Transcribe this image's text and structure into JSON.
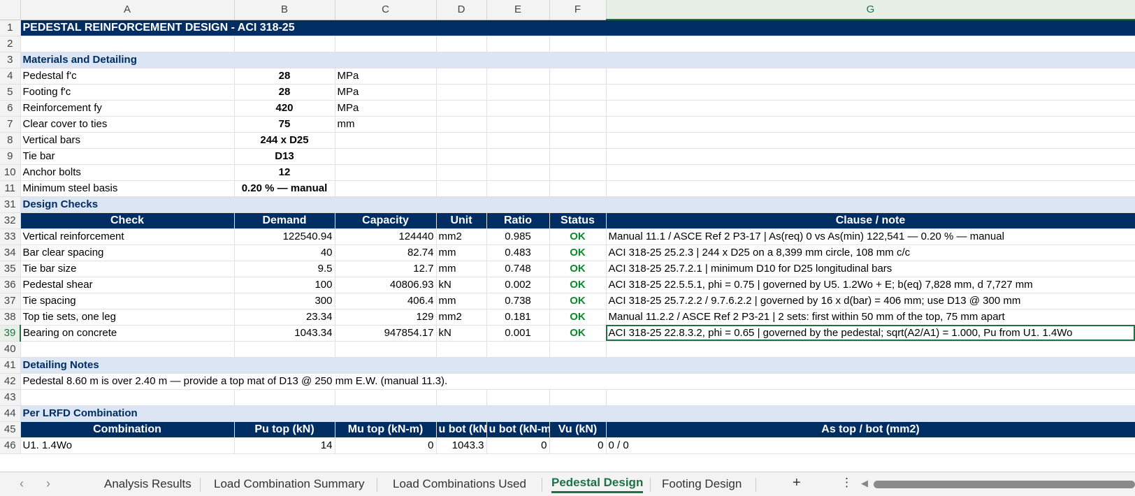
{
  "columns": {
    "a": "A",
    "b": "B",
    "c": "C",
    "d": "D",
    "e": "E",
    "f": "F",
    "g": "G"
  },
  "rows_num": {
    "r1": "1",
    "r2": "2",
    "r3": "3",
    "r4": "4",
    "r5": "5",
    "r6": "6",
    "r7": "7",
    "r8": "8",
    "r9": "9",
    "r10": "10",
    "r11": "11",
    "r31": "31",
    "r32": "32",
    "r33": "33",
    "r34": "34",
    "r35": "35",
    "r36": "36",
    "r37": "37",
    "r38": "38",
    "r39": "39",
    "r40": "40",
    "r41": "41",
    "r42": "42",
    "r43": "43",
    "r44": "44",
    "r45": "45",
    "r46": "46"
  },
  "title": "PEDESTAL REINFORCEMENT DESIGN - ACI 318-25",
  "materials": {
    "heading": "Materials and Detailing",
    "items": [
      {
        "label": "Pedestal f'c",
        "value": "28",
        "unit": "MPa"
      },
      {
        "label": "Footing f'c",
        "value": "28",
        "unit": "MPa"
      },
      {
        "label": "Reinforcement fy",
        "value": "420",
        "unit": "MPa"
      },
      {
        "label": "Clear cover to ties",
        "value": "75",
        "unit": "mm"
      },
      {
        "label": "Vertical bars",
        "value": "244 x D25",
        "unit": ""
      },
      {
        "label": "Tie bar",
        "value": "D13",
        "unit": ""
      },
      {
        "label": "Anchor bolts",
        "value": "12",
        "unit": ""
      },
      {
        "label": "Minimum steel basis",
        "value": "0.20 % — manual",
        "unit": ""
      }
    ]
  },
  "checks": {
    "heading": "Design Checks",
    "headers": {
      "check": "Check",
      "demand": "Demand",
      "capacity": "Capacity",
      "unit": "Unit",
      "ratio": "Ratio",
      "status": "Status",
      "clause": "Clause / note"
    },
    "rows": [
      {
        "check": "Vertical reinforcement",
        "demand": "122540.94",
        "capacity": "124440",
        "unit": "mm2",
        "ratio": "0.985",
        "status": "OK",
        "clause": "Manual 11.1 / ASCE Ref 2 P3-17  |  As(req) 0 vs As(min) 122,541 — 0.20 % — manual"
      },
      {
        "check": "Bar clear spacing",
        "demand": "40",
        "capacity": "82.74",
        "unit": "mm",
        "ratio": "0.483",
        "status": "OK",
        "clause": "ACI 318-25 25.2.3  |  244 x D25 on a 8,399 mm circle, 108 mm c/c"
      },
      {
        "check": "Tie bar size",
        "demand": "9.5",
        "capacity": "12.7",
        "unit": "mm",
        "ratio": "0.748",
        "status": "OK",
        "clause": "ACI 318-25 25.7.2.1  |  minimum D10 for D25 longitudinal bars"
      },
      {
        "check": "Pedestal shear",
        "demand": "100",
        "capacity": "40806.93",
        "unit": "kN",
        "ratio": "0.002",
        "status": "OK",
        "clause": "ACI 318-25 22.5.5.1, phi = 0.75  |  governed by U5. 1.2Wo + E; b(eq) 7,828 mm, d 7,727 mm"
      },
      {
        "check": "Tie spacing",
        "demand": "300",
        "capacity": "406.4",
        "unit": "mm",
        "ratio": "0.738",
        "status": "OK",
        "clause": "ACI 318-25 25.7.2.2 / 9.7.6.2.2  |  governed by 16 x d(bar) = 406 mm; use D13 @ 300 mm"
      },
      {
        "check": "Top tie sets, one leg",
        "demand": "23.34",
        "capacity": "129",
        "unit": "mm2",
        "ratio": "0.181",
        "status": "OK",
        "clause": "Manual 11.2.2 / ASCE Ref 2 P3-21  |  2 sets: first within 50 mm of the top, 75 mm apart"
      },
      {
        "check": "Bearing on concrete",
        "demand": "1043.34",
        "capacity": "947854.17",
        "unit": "kN",
        "ratio": "0.001",
        "status": "OK",
        "clause": "ACI 318-25 22.8.3.2, phi = 0.65  |  governed by the pedestal; sqrt(A2/A1) = 1.000, Pu from U1. 1.4Wo"
      }
    ]
  },
  "notes": {
    "heading": "Detailing Notes",
    "text": "Pedestal 8.60 m is over 2.40 m — provide a top mat of D13 @ 250 mm E.W. (manual 11.3)."
  },
  "lrfd": {
    "heading": "Per LRFD Combination",
    "headers": {
      "combination": "Combination",
      "pu_top": "Pu top (kN)",
      "mu_top": "Mu top (kN-m)",
      "pu_bot": "u bot (kN",
      "mu_bot": "u bot (kN-m",
      "vu": "Vu (kN)",
      "as": "As top / bot (mm2)"
    },
    "row": {
      "combination": "U1. 1.4Wo",
      "pu_top": "14",
      "mu_top": "0",
      "pu_bot": "1043.3",
      "mu_bot": "0",
      "vu": "0",
      "as": "0 / 0"
    }
  },
  "tabs": {
    "t1": "Analysis Results",
    "t2": "Load Combination Summary",
    "t3": "Load Combinations Used",
    "t4": "Pedestal Design",
    "t5": "Footing Design",
    "add": "+",
    "more": "⋮",
    "prev": "‹",
    "next": "›",
    "scroll_left": "◀"
  },
  "colors": {
    "header_navy": "#002d62",
    "section_blue": "#dce5f3",
    "ok_green": "#0a8a2a",
    "excel_green": "#1e7145"
  }
}
